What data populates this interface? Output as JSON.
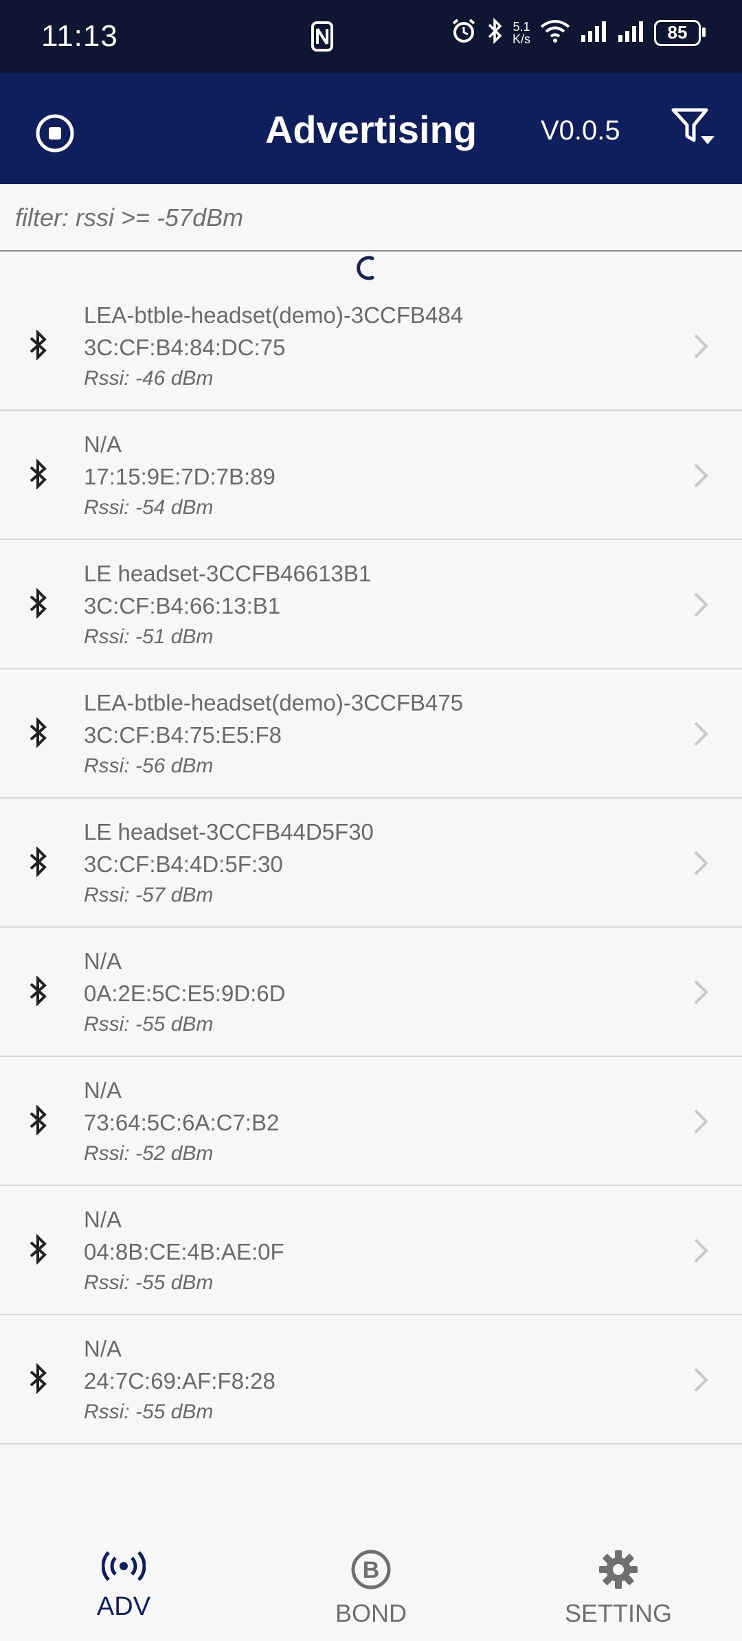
{
  "status_bar": {
    "time": "11:13",
    "speed_value": "5.1",
    "speed_unit": "K/s",
    "battery": "85"
  },
  "appbar": {
    "title": "Advertising",
    "version": "V0.0.5"
  },
  "filter": {
    "text": "filter: rssi >= -57dBm"
  },
  "devices": [
    {
      "name": "LEA-btble-headset(demo)-3CCFB484",
      "mac": "3C:CF:B4:84:DC:75",
      "rssi": "Rssi: -46 dBm"
    },
    {
      "name": "N/A",
      "mac": "17:15:9E:7D:7B:89",
      "rssi": "Rssi: -54 dBm"
    },
    {
      "name": "LE headset-3CCFB46613B1",
      "mac": "3C:CF:B4:66:13:B1",
      "rssi": "Rssi: -51 dBm"
    },
    {
      "name": "LEA-btble-headset(demo)-3CCFB475",
      "mac": "3C:CF:B4:75:E5:F8",
      "rssi": "Rssi: -56 dBm"
    },
    {
      "name": "LE headset-3CCFB44D5F30",
      "mac": "3C:CF:B4:4D:5F:30",
      "rssi": "Rssi: -57 dBm"
    },
    {
      "name": "N/A",
      "mac": "0A:2E:5C:E5:9D:6D",
      "rssi": "Rssi: -55 dBm"
    },
    {
      "name": "N/A",
      "mac": "73:64:5C:6A:C7:B2",
      "rssi": "Rssi: -52 dBm"
    },
    {
      "name": "N/A",
      "mac": "04:8B:CE:4B:AE:0F",
      "rssi": "Rssi: -55 dBm"
    },
    {
      "name": "N/A",
      "mac": "24:7C:69:AF:F8:28",
      "rssi": "Rssi: -55 dBm"
    }
  ],
  "nav": {
    "adv": "ADV",
    "bond": "BOND",
    "setting": "SETTING"
  },
  "colors": {
    "status_bar": "#0f1631",
    "app_bar": "#0f1f5c",
    "active_tab": "#0f1f5c"
  }
}
